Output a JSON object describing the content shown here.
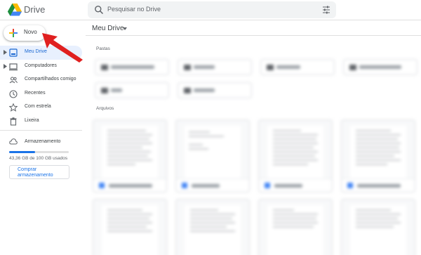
{
  "header": {
    "brand": "Drive",
    "search_placeholder": "Pesquisar no Drive"
  },
  "sidebar": {
    "new_button": "Novo",
    "items": [
      {
        "label": "Meu Drive",
        "icon": "my-drive-icon",
        "active": true
      },
      {
        "label": "Computadores",
        "icon": "computer-icon",
        "active": false
      },
      {
        "label": "Compartilhados comigo",
        "icon": "shared-people-icon",
        "active": false
      },
      {
        "label": "Recentes",
        "icon": "clock-icon",
        "active": false
      },
      {
        "label": "Com estrela",
        "icon": "star-icon",
        "active": false
      },
      {
        "label": "Lixeira",
        "icon": "trash-icon",
        "active": false
      }
    ],
    "storage": {
      "label": "Armazenamento",
      "usage_text": "43,36 GB de 100 GB usados",
      "used_fraction": 0.4336,
      "buy_button": "Comprar armazenamento"
    }
  },
  "main": {
    "title": "Meu Drive",
    "folders_label": "Pastas",
    "files_label": "Arquivos"
  },
  "colors": {
    "accent": "#1a73e8",
    "active_bg": "#e8f0fe",
    "annotation_arrow": "#e02020"
  }
}
